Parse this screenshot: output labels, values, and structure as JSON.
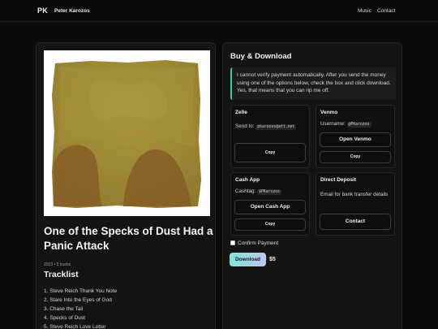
{
  "header": {
    "logo": "PK",
    "site_name": "Peter Karozos",
    "nav": [
      "Music",
      "Contact"
    ]
  },
  "album": {
    "title": "One of the Specks of Dust Had a Panic Attack",
    "meta": "2023 • 5 tracks",
    "tracklist_heading": "Tracklist",
    "tracks": [
      "1. Steve Reich Thank You Note",
      "2. Stare Into the Eyes of God",
      "3. Chase the Tail",
      "4. Specks of Dust",
      "5. Steve Reich Love Letter"
    ]
  },
  "purchase": {
    "heading": "Buy & Download",
    "notice": "I cannot verify payment automatically. After you send the money using one of the options below, check the box and click download. Yes, that means that you can rip me off.",
    "zelle": {
      "title": "Zelle",
      "label": "Send to:",
      "value": "pkarozos@att.net",
      "copy": "Copy"
    },
    "venmo": {
      "title": "Venmo",
      "label": "Username:",
      "value": "@PKarozos",
      "open": "Open Venmo",
      "copy": "Copy"
    },
    "cashapp": {
      "title": "Cash App",
      "label": "Cashtag:",
      "value": "$PKarozos",
      "open": "Open Cash App",
      "copy": "Copy"
    },
    "direct": {
      "title": "Direct Deposit",
      "description": "Email for bank transfer details",
      "contact": "Contact"
    },
    "confirm_label": "Confirm Payment",
    "confirm_checked": false,
    "download_label": "Download",
    "price": "$5",
    "accent_color": "#46c9a8"
  }
}
